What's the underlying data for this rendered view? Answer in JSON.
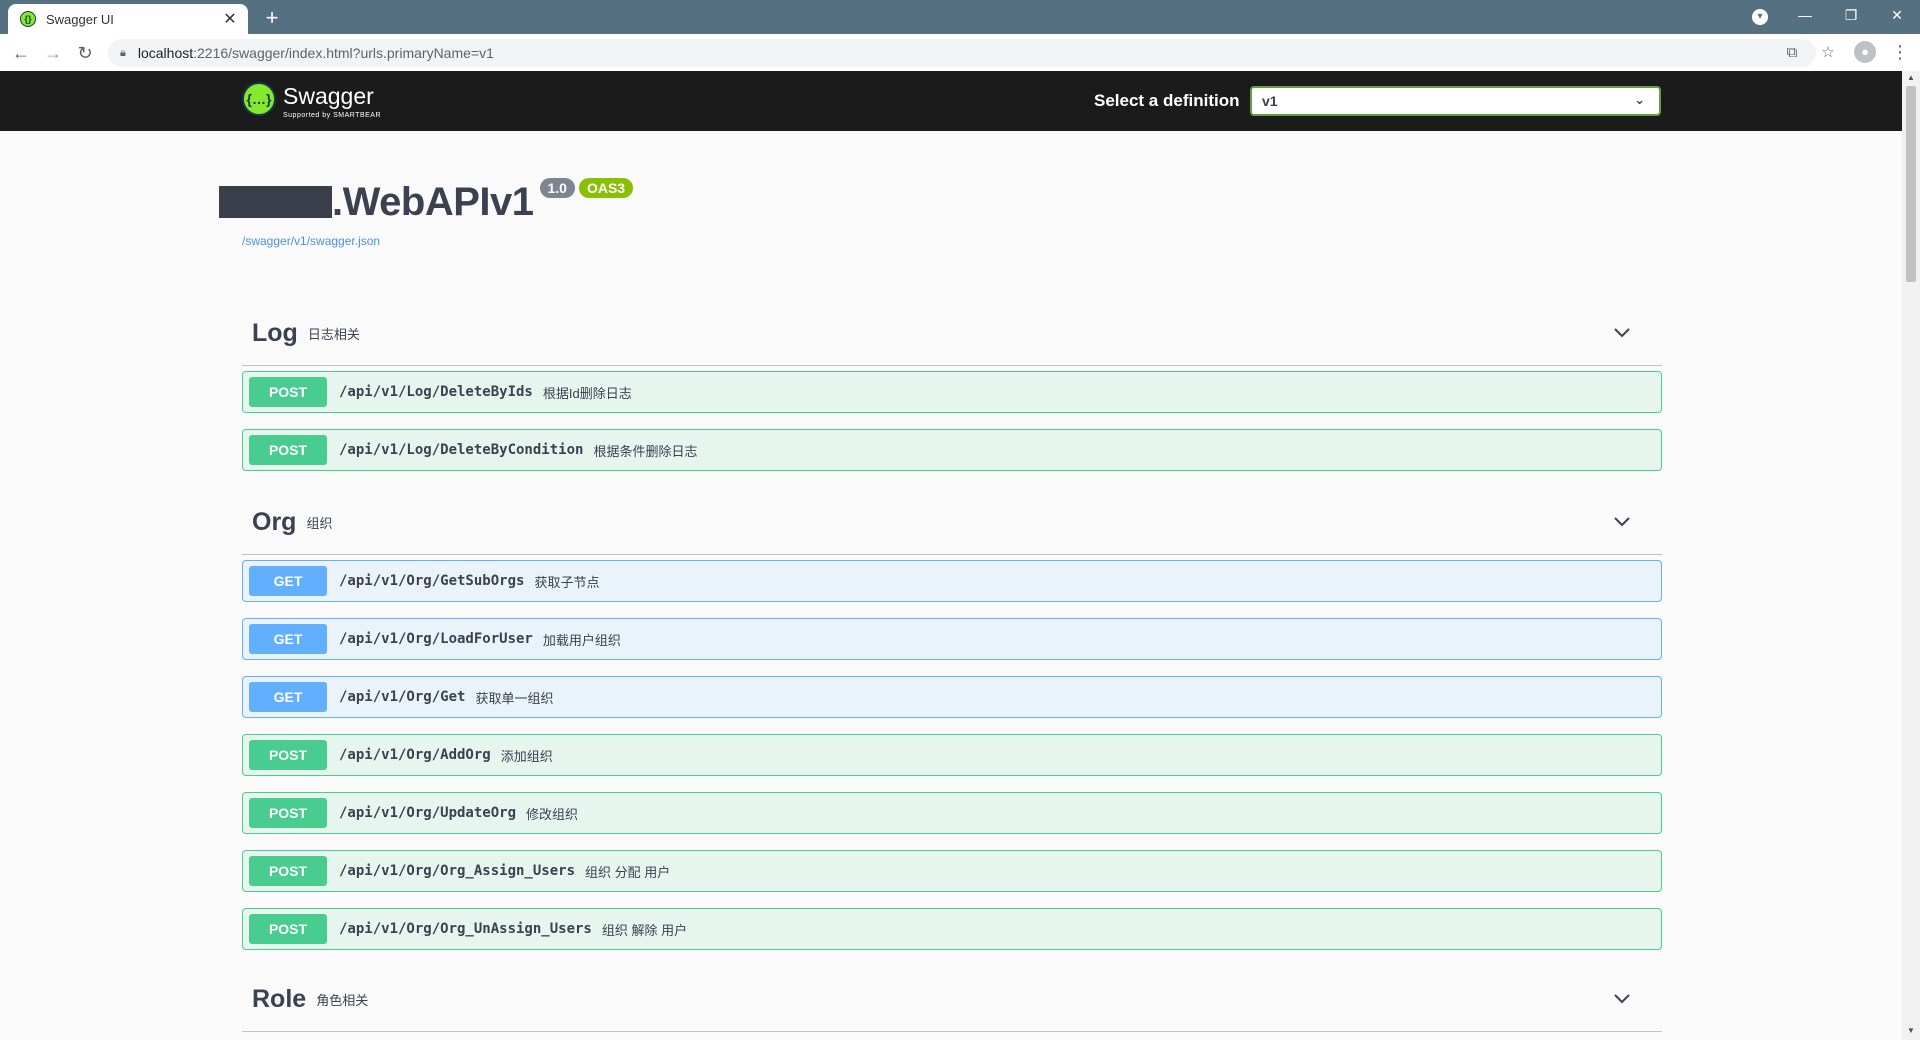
{
  "browser": {
    "tab_title": "Swagger UI",
    "url_host": "localhost",
    "url_rest": ":2216/swagger/index.html?urls.primaryName=v1"
  },
  "topbar": {
    "logo_text": "Swagger",
    "logo_sub": "Supported by SMARTBEAR",
    "definition_label": "Select a definition",
    "definition_value": "v1"
  },
  "info": {
    "title": ".WebAPIv1",
    "version": "1.0",
    "oas": "OAS3",
    "json_link": "/swagger/v1/swagger.json"
  },
  "sections": [
    {
      "name": "Log",
      "desc": "日志相关",
      "ops": [
        {
          "method": "POST",
          "path": "/api/v1/Log/DeleteByIds",
          "summary": "根据Id删除日志"
        },
        {
          "method": "POST",
          "path": "/api/v1/Log/DeleteByCondition",
          "summary": "根据条件删除日志"
        }
      ]
    },
    {
      "name": "Org",
      "desc": "组织",
      "ops": [
        {
          "method": "GET",
          "path": "/api/v1/Org/GetSubOrgs",
          "summary": "获取子节点"
        },
        {
          "method": "GET",
          "path": "/api/v1/Org/LoadForUser",
          "summary": "加载用户组织"
        },
        {
          "method": "GET",
          "path": "/api/v1/Org/Get",
          "summary": "获取单一组织"
        },
        {
          "method": "POST",
          "path": "/api/v1/Org/AddOrg",
          "summary": "添加组织"
        },
        {
          "method": "POST",
          "path": "/api/v1/Org/UpdateOrg",
          "summary": "修改组织"
        },
        {
          "method": "POST",
          "path": "/api/v1/Org/Org_Assign_Users",
          "summary": "组织 分配 用户"
        },
        {
          "method": "POST",
          "path": "/api/v1/Org/Org_UnAssign_Users",
          "summary": "组织 解除 用户"
        }
      ]
    },
    {
      "name": "Role",
      "desc": "角色相关",
      "ops": []
    }
  ],
  "colors": {
    "post": "#49cc90",
    "get": "#61affe",
    "topbar": "#1b1b1b",
    "swagger_green": "#85ea2d"
  }
}
